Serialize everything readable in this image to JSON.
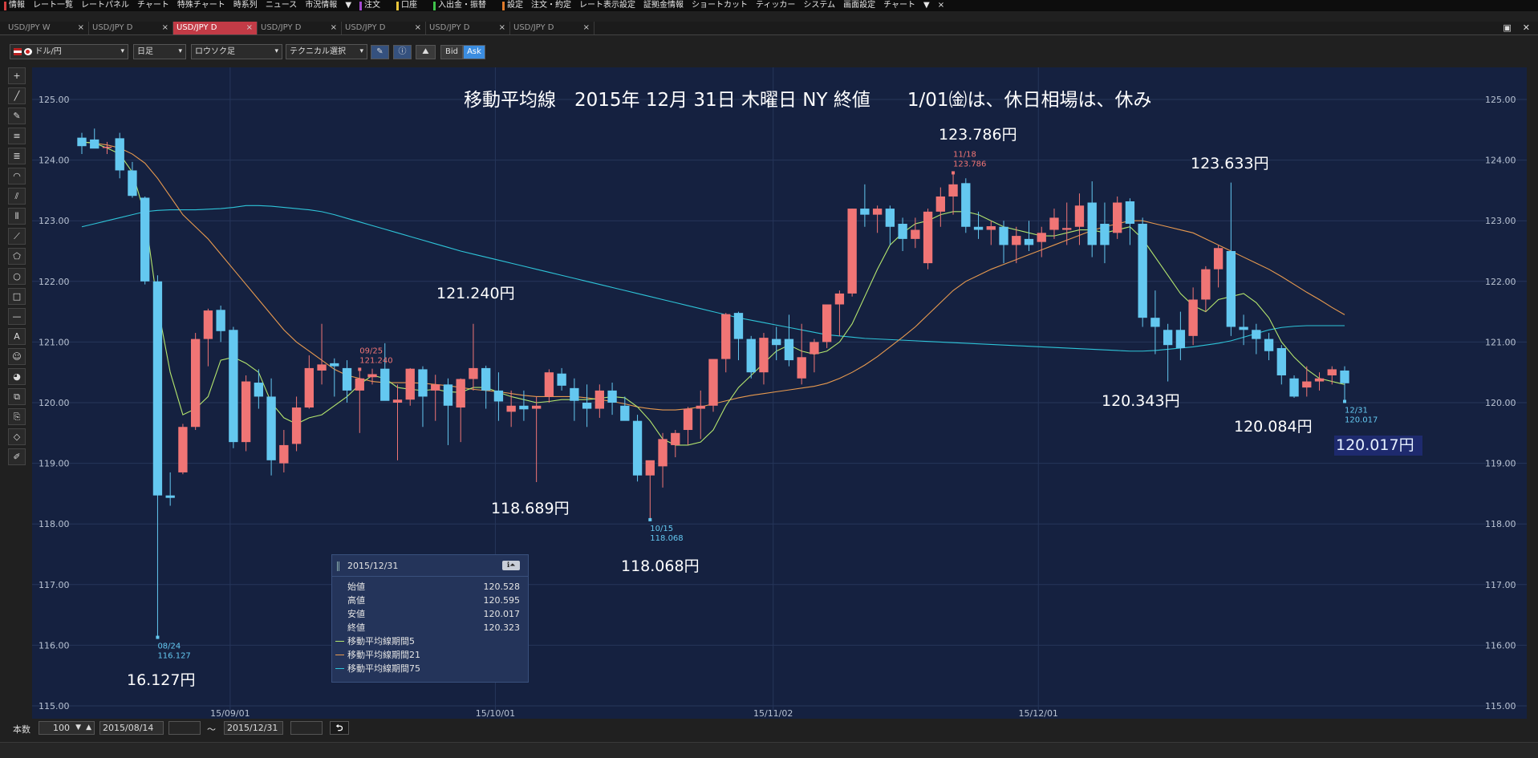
{
  "menu": [
    {
      "label": "情報",
      "marker": "#d34040"
    },
    {
      "label": "レート一覧"
    },
    {
      "label": "レートパネル"
    },
    {
      "label": "チャート"
    },
    {
      "label": "特殊チャート"
    },
    {
      "label": "時系列"
    },
    {
      "label": "ニュース"
    },
    {
      "label": "市況情報"
    },
    {
      "label": "▼"
    },
    {
      "label": "注文",
      "marker": "#a44ad2"
    },
    {
      "label": ""
    },
    {
      "label": "口座",
      "marker": "#e8c43a"
    },
    {
      "label": ""
    },
    {
      "label": "入出金・振替",
      "marker": "#3fc24a"
    },
    {
      "label": ""
    },
    {
      "label": "設定",
      "marker": "#e07a2a"
    },
    {
      "label": "注文・約定"
    },
    {
      "label": "レート表示設定"
    },
    {
      "label": "証拠金情報"
    },
    {
      "label": "ショートカット"
    },
    {
      "label": "ティッカー"
    },
    {
      "label": "システム"
    },
    {
      "label": "画面設定"
    },
    {
      "label": "チャート"
    },
    {
      "label": "▼"
    },
    {
      "label": "×"
    }
  ],
  "tabs": [
    {
      "label": "USD/JPY W",
      "active": false
    },
    {
      "label": "USD/JPY D",
      "active": false
    },
    {
      "label": "USD/JPY D",
      "active": true
    },
    {
      "label": "USD/JPY D",
      "active": false
    },
    {
      "label": "USD/JPY D",
      "active": false
    },
    {
      "label": "USD/JPY D",
      "active": false
    },
    {
      "label": "USD/JPY D",
      "active": false
    }
  ],
  "tab_close": "×",
  "window_buttons": [
    "▣",
    "✕"
  ],
  "toolbar": {
    "currency": "ドル/円",
    "timeframe": "日足",
    "chart_type": "ロウソク足",
    "technical": "テクニカル選択",
    "bid": "Bid",
    "ask": "Ask",
    "dropdown_arrow": "▾"
  },
  "left_tools": [
    "+",
    "╱",
    "✎",
    "≡",
    "≣",
    "◠",
    "⫽",
    "⦀",
    "⟋",
    "⬠",
    "○",
    "□",
    "—",
    "A",
    "☺",
    "◕",
    "⧉",
    "⎘",
    "◇",
    "✐"
  ],
  "chart_data": {
    "type": "candlestick",
    "title": "移動平均線　2015年 12月 31日 木曜日 NY 終値　　1/01㈮は、休日相場は、休み",
    "y_ticks": [
      "125.00",
      "124.00",
      "123.00",
      "122.00",
      "121.00",
      "120.00",
      "119.00",
      "118.00",
      "117.00",
      "116.00",
      "115.00"
    ],
    "ylim": [
      115.0,
      125.0
    ],
    "x_ticks": [
      "15/09/01",
      "15/10/01",
      "15/11/02",
      "15/12/01"
    ],
    "up_color": "#f07575",
    "down_color": "#64c8f0",
    "candles": [
      {
        "o": 124.37,
        "h": 124.45,
        "l": 124.1,
        "c": 124.23
      },
      {
        "o": 124.34,
        "h": 124.52,
        "l": 124.2,
        "c": 124.19
      },
      {
        "o": 124.2,
        "h": 124.3,
        "l": 124.1,
        "c": 124.22
      },
      {
        "o": 124.36,
        "h": 124.45,
        "l": 123.7,
        "c": 123.83
      },
      {
        "o": 123.83,
        "h": 123.97,
        "l": 123.38,
        "c": 123.41
      },
      {
        "o": 123.38,
        "h": 123.4,
        "l": 121.95,
        "c": 122.0
      },
      {
        "o": 122.0,
        "h": 122.1,
        "l": 116.13,
        "c": 118.47
      },
      {
        "o": 118.47,
        "h": 118.85,
        "l": 118.3,
        "c": 118.43
      },
      {
        "o": 118.85,
        "h": 119.65,
        "l": 118.82,
        "c": 119.6
      },
      {
        "o": 119.6,
        "h": 121.15,
        "l": 119.55,
        "c": 121.05
      },
      {
        "o": 121.05,
        "h": 121.55,
        "l": 120.6,
        "c": 121.52
      },
      {
        "o": 121.53,
        "h": 121.6,
        "l": 121.0,
        "c": 121.18
      },
      {
        "o": 121.2,
        "h": 121.25,
        "l": 119.25,
        "c": 119.35
      },
      {
        "o": 119.35,
        "h": 120.45,
        "l": 119.2,
        "c": 120.35
      },
      {
        "o": 120.33,
        "h": 120.55,
        "l": 119.9,
        "c": 120.1
      },
      {
        "o": 120.1,
        "h": 120.4,
        "l": 118.8,
        "c": 119.05
      },
      {
        "o": 119.0,
        "h": 119.55,
        "l": 118.85,
        "c": 119.3
      },
      {
        "o": 119.32,
        "h": 120.1,
        "l": 119.2,
        "c": 119.92
      },
      {
        "o": 119.92,
        "h": 120.78,
        "l": 119.9,
        "c": 120.57
      },
      {
        "o": 120.53,
        "h": 121.3,
        "l": 120.3,
        "c": 120.63
      },
      {
        "o": 120.65,
        "h": 120.73,
        "l": 120.1,
        "c": 120.6
      },
      {
        "o": 120.57,
        "h": 120.7,
        "l": 120.0,
        "c": 120.2
      },
      {
        "o": 120.2,
        "h": 120.55,
        "l": 119.5,
        "c": 120.4
      },
      {
        "o": 120.42,
        "h": 120.56,
        "l": 120.3,
        "c": 120.47
      },
      {
        "o": 120.56,
        "h": 120.98,
        "l": 120.1,
        "c": 120.03
      },
      {
        "o": 120.0,
        "h": 120.3,
        "l": 119.05,
        "c": 120.05
      },
      {
        "o": 120.05,
        "h": 120.57,
        "l": 119.95,
        "c": 120.56
      },
      {
        "o": 120.55,
        "h": 120.6,
        "l": 119.6,
        "c": 120.1
      },
      {
        "o": 120.2,
        "h": 120.46,
        "l": 119.7,
        "c": 120.3
      },
      {
        "o": 120.3,
        "h": 120.4,
        "l": 119.3,
        "c": 119.95
      },
      {
        "o": 119.92,
        "h": 120.4,
        "l": 119.35,
        "c": 120.39
      },
      {
        "o": 120.39,
        "h": 121.3,
        "l": 120.2,
        "c": 120.57
      },
      {
        "o": 120.57,
        "h": 120.61,
        "l": 119.9,
        "c": 120.2
      },
      {
        "o": 120.2,
        "h": 120.5,
        "l": 119.7,
        "c": 120.02
      },
      {
        "o": 119.85,
        "h": 120.2,
        "l": 119.6,
        "c": 119.95
      },
      {
        "o": 119.95,
        "h": 120.2,
        "l": 119.7,
        "c": 119.89
      },
      {
        "o": 119.9,
        "h": 120.1,
        "l": 118.69,
        "c": 119.95
      },
      {
        "o": 120.1,
        "h": 120.55,
        "l": 120.0,
        "c": 120.5
      },
      {
        "o": 120.48,
        "h": 120.57,
        "l": 120.2,
        "c": 120.28
      },
      {
        "o": 120.24,
        "h": 120.4,
        "l": 119.7,
        "c": 120.03
      },
      {
        "o": 120.0,
        "h": 120.3,
        "l": 119.6,
        "c": 119.9
      },
      {
        "o": 119.9,
        "h": 120.3,
        "l": 119.75,
        "c": 120.2
      },
      {
        "o": 120.2,
        "h": 120.33,
        "l": 119.8,
        "c": 120.0
      },
      {
        "o": 119.95,
        "h": 120.1,
        "l": 119.75,
        "c": 119.7
      },
      {
        "o": 119.7,
        "h": 119.8,
        "l": 118.7,
        "c": 118.8
      },
      {
        "o": 118.8,
        "h": 119.0,
        "l": 118.07,
        "c": 119.05
      },
      {
        "o": 118.95,
        "h": 119.5,
        "l": 118.6,
        "c": 119.4
      },
      {
        "o": 119.3,
        "h": 119.55,
        "l": 119.1,
        "c": 119.5
      },
      {
        "o": 119.55,
        "h": 119.93,
        "l": 119.3,
        "c": 119.9
      },
      {
        "o": 119.9,
        "h": 120.2,
        "l": 119.4,
        "c": 119.95
      },
      {
        "o": 119.95,
        "h": 120.7,
        "l": 119.85,
        "c": 120.72
      },
      {
        "o": 120.72,
        "h": 121.48,
        "l": 120.5,
        "c": 121.46
      },
      {
        "o": 121.48,
        "h": 121.5,
        "l": 120.7,
        "c": 121.05
      },
      {
        "o": 121.05,
        "h": 121.1,
        "l": 120.4,
        "c": 120.5
      },
      {
        "o": 120.5,
        "h": 121.15,
        "l": 120.3,
        "c": 121.07
      },
      {
        "o": 121.05,
        "h": 121.25,
        "l": 120.7,
        "c": 120.95
      },
      {
        "o": 121.05,
        "h": 121.45,
        "l": 120.6,
        "c": 120.7
      },
      {
        "o": 120.4,
        "h": 121.3,
        "l": 120.3,
        "c": 120.75
      },
      {
        "o": 120.8,
        "h": 121.05,
        "l": 120.5,
        "c": 121.0
      },
      {
        "o": 121.0,
        "h": 121.55,
        "l": 120.9,
        "c": 121.62
      },
      {
        "o": 121.62,
        "h": 121.85,
        "l": 121.1,
        "c": 121.8
      },
      {
        "o": 121.8,
        "h": 123.2,
        "l": 121.75,
        "c": 123.2
      },
      {
        "o": 123.2,
        "h": 123.6,
        "l": 122.9,
        "c": 123.1
      },
      {
        "o": 123.1,
        "h": 123.25,
        "l": 122.8,
        "c": 123.2
      },
      {
        "o": 123.2,
        "h": 123.25,
        "l": 122.6,
        "c": 122.9
      },
      {
        "o": 122.95,
        "h": 123.05,
        "l": 122.5,
        "c": 122.7
      },
      {
        "o": 122.7,
        "h": 123.05,
        "l": 122.55,
        "c": 122.85
      },
      {
        "o": 122.3,
        "h": 123.2,
        "l": 122.2,
        "c": 123.15
      },
      {
        "o": 123.15,
        "h": 123.55,
        "l": 122.9,
        "c": 123.4
      },
      {
        "o": 123.4,
        "h": 123.79,
        "l": 123.1,
        "c": 123.6
      },
      {
        "o": 123.62,
        "h": 123.7,
        "l": 122.8,
        "c": 122.9
      },
      {
        "o": 122.9,
        "h": 123.15,
        "l": 122.7,
        "c": 122.85
      },
      {
        "o": 122.85,
        "h": 123.0,
        "l": 122.6,
        "c": 122.91
      },
      {
        "o": 122.9,
        "h": 123.0,
        "l": 122.3,
        "c": 122.6
      },
      {
        "o": 122.6,
        "h": 122.9,
        "l": 122.3,
        "c": 122.75
      },
      {
        "o": 122.7,
        "h": 123.0,
        "l": 122.5,
        "c": 122.6
      },
      {
        "o": 122.65,
        "h": 122.9,
        "l": 122.4,
        "c": 122.8
      },
      {
        "o": 122.85,
        "h": 123.2,
        "l": 122.7,
        "c": 123.05
      },
      {
        "o": 122.85,
        "h": 123.3,
        "l": 122.6,
        "c": 122.88
      },
      {
        "o": 122.9,
        "h": 123.45,
        "l": 122.6,
        "c": 123.25
      },
      {
        "o": 123.3,
        "h": 123.65,
        "l": 122.4,
        "c": 122.6
      },
      {
        "o": 122.95,
        "h": 123.3,
        "l": 122.3,
        "c": 122.6
      },
      {
        "o": 122.8,
        "h": 123.4,
        "l": 122.7,
        "c": 123.3
      },
      {
        "o": 123.32,
        "h": 123.37,
        "l": 122.6,
        "c": 122.95
      },
      {
        "o": 122.95,
        "h": 123.05,
        "l": 121.25,
        "c": 121.4
      },
      {
        "o": 121.4,
        "h": 121.85,
        "l": 120.8,
        "c": 121.25
      },
      {
        "o": 121.2,
        "h": 121.3,
        "l": 120.35,
        "c": 120.95
      },
      {
        "o": 121.2,
        "h": 121.5,
        "l": 120.7,
        "c": 120.9
      },
      {
        "o": 121.1,
        "h": 121.9,
        "l": 120.95,
        "c": 121.7
      },
      {
        "o": 121.7,
        "h": 122.25,
        "l": 121.5,
        "c": 122.2
      },
      {
        "o": 122.2,
        "h": 122.6,
        "l": 121.9,
        "c": 122.55
      },
      {
        "o": 122.5,
        "h": 123.63,
        "l": 121.1,
        "c": 121.25
      },
      {
        "o": 121.25,
        "h": 121.45,
        "l": 120.95,
        "c": 121.2
      },
      {
        "o": 121.2,
        "h": 121.3,
        "l": 120.8,
        "c": 121.05
      },
      {
        "o": 121.05,
        "h": 121.15,
        "l": 120.7,
        "c": 120.85
      },
      {
        "o": 120.9,
        "h": 120.95,
        "l": 120.3,
        "c": 120.45
      },
      {
        "o": 120.4,
        "h": 120.45,
        "l": 120.08,
        "c": 120.1
      },
      {
        "o": 120.25,
        "h": 120.6,
        "l": 120.1,
        "c": 120.35
      },
      {
        "o": 120.35,
        "h": 120.5,
        "l": 120.2,
        "c": 120.4
      },
      {
        "o": 120.45,
        "h": 120.6,
        "l": 120.3,
        "c": 120.55
      },
      {
        "o": 120.53,
        "h": 120.6,
        "l": 120.02,
        "c": 120.32
      }
    ],
    "ma5": [
      124.3,
      124.28,
      124.2,
      124.1,
      123.8,
      123.1,
      121.6,
      120.5,
      119.8,
      119.9,
      120.1,
      120.7,
      120.75,
      120.65,
      120.5,
      120.0,
      119.75,
      119.65,
      119.75,
      119.8,
      119.95,
      120.1,
      120.3,
      120.45,
      120.4,
      120.25,
      120.22,
      120.2,
      120.22,
      120.18,
      120.17,
      120.25,
      120.25,
      120.17,
      120.1,
      120.05,
      120.0,
      120.02,
      120.05,
      120.05,
      120.05,
      120.07,
      120.1,
      120.08,
      119.93,
      119.7,
      119.4,
      119.3,
      119.3,
      119.35,
      119.55,
      119.95,
      120.25,
      120.45,
      120.65,
      120.85,
      120.95,
      120.85,
      120.8,
      120.85,
      121.0,
      121.3,
      121.75,
      122.2,
      122.6,
      122.8,
      122.95,
      123.0,
      123.1,
      123.15,
      123.15,
      123.1,
      123.0,
      122.9,
      122.85,
      122.8,
      122.75,
      122.75,
      122.8,
      122.85,
      122.85,
      122.8,
      122.85,
      122.9,
      122.7,
      122.4,
      122.1,
      121.8,
      121.6,
      121.5,
      121.7,
      121.75,
      121.8,
      121.65,
      121.4,
      121.0,
      120.75,
      120.55,
      120.4,
      120.35,
      120.3
    ],
    "ma21": [
      124.3,
      124.28,
      124.25,
      124.2,
      124.1,
      123.95,
      123.7,
      123.4,
      123.1,
      122.9,
      122.7,
      122.45,
      122.2,
      121.95,
      121.7,
      121.45,
      121.2,
      121.0,
      120.85,
      120.7,
      120.55,
      120.45,
      120.4,
      120.35,
      120.33,
      120.33,
      120.33,
      120.32,
      120.3,
      120.28,
      120.25,
      120.22,
      120.2,
      120.18,
      120.15,
      120.12,
      120.1,
      120.1,
      120.1,
      120.1,
      120.08,
      120.05,
      120.02,
      119.98,
      119.93,
      119.9,
      119.88,
      119.88,
      119.9,
      119.93,
      119.98,
      120.03,
      120.08,
      120.12,
      120.15,
      120.18,
      120.21,
      120.24,
      120.27,
      120.32,
      120.4,
      120.5,
      120.62,
      120.76,
      120.92,
      121.08,
      121.25,
      121.45,
      121.65,
      121.85,
      122.0,
      122.1,
      122.2,
      122.28,
      122.36,
      122.44,
      122.52,
      122.6,
      122.68,
      122.76,
      122.84,
      122.9,
      122.95,
      123.0,
      123.0,
      122.95,
      122.9,
      122.85,
      122.8,
      122.7,
      122.6,
      122.5,
      122.4,
      122.3,
      122.2,
      122.08,
      121.95,
      121.82,
      121.7,
      121.57,
      121.45
    ],
    "ma75": [
      122.9,
      122.95,
      123.0,
      123.05,
      123.1,
      123.15,
      123.17,
      123.18,
      123.18,
      123.18,
      123.19,
      123.2,
      123.22,
      123.25,
      123.25,
      123.24,
      123.22,
      123.2,
      123.18,
      123.15,
      123.1,
      123.04,
      122.98,
      122.92,
      122.86,
      122.8,
      122.74,
      122.68,
      122.62,
      122.56,
      122.5,
      122.45,
      122.4,
      122.35,
      122.3,
      122.25,
      122.2,
      122.15,
      122.1,
      122.05,
      122.0,
      121.95,
      121.9,
      121.85,
      121.8,
      121.75,
      121.7,
      121.65,
      121.6,
      121.55,
      121.5,
      121.45,
      121.4,
      121.36,
      121.32,
      121.28,
      121.24,
      121.2,
      121.16,
      121.12,
      121.1,
      121.08,
      121.06,
      121.05,
      121.04,
      121.03,
      121.02,
      121.01,
      121.0,
      120.99,
      120.98,
      120.97,
      120.96,
      120.95,
      120.94,
      120.93,
      120.92,
      120.91,
      120.9,
      120.89,
      120.88,
      120.87,
      120.86,
      120.85,
      120.85,
      120.86,
      120.88,
      120.9,
      120.92,
      120.95,
      120.98,
      121.02,
      121.08,
      121.14,
      121.2,
      121.24,
      121.26,
      121.27,
      121.27,
      121.27,
      121.27
    ],
    "ma_colors": {
      "ma5": "#b4e66e",
      "ma21": "#e89a4f",
      "ma75": "#2ec4d8"
    },
    "markers": [
      {
        "idx": 6,
        "side": "low",
        "date": "08/24",
        "value": "116.127"
      },
      {
        "idx": 22,
        "side": "high",
        "date": "09/25",
        "value": "121.240"
      },
      {
        "idx": 45,
        "side": "low",
        "date": "10/15",
        "value": "118.068"
      },
      {
        "idx": 69,
        "side": "high",
        "date": "11/18",
        "value": "123.786"
      },
      {
        "idx": 100,
        "side": "low",
        "date": "12/31",
        "value": "120.017"
      }
    ],
    "annotations": [
      {
        "text": "16.127円",
        "near": "bottom-left"
      },
      {
        "text": "121.240円",
        "near": "09/25 high"
      },
      {
        "text": "118.689円",
        "near": "10/06 low"
      },
      {
        "text": "118.068円",
        "near": "10/15 low"
      },
      {
        "text": "123.786円",
        "near": "11/18 high"
      },
      {
        "text": "123.633円",
        "near": "12/18 high"
      },
      {
        "text": "120.343円",
        "near": "12/09 low"
      },
      {
        "text": "120.084円",
        "near": "12/23 low"
      },
      {
        "text": "120.017円",
        "near": "12/31 low",
        "highlight": true
      }
    ]
  },
  "infobox": {
    "date": "2015/12/31",
    "rows": [
      {
        "label": "始値",
        "value": "120.528"
      },
      {
        "label": "高値",
        "value": "120.595"
      },
      {
        "label": "安値",
        "value": "120.017"
      },
      {
        "label": "終値",
        "value": "120.323"
      }
    ],
    "ma_legend": [
      {
        "label": "移動平均線期間5",
        "color": "#b4e66e"
      },
      {
        "label": "移動平均線期間21",
        "color": "#e89a4f"
      },
      {
        "label": "移動平均線期間75",
        "color": "#2ec4d8"
      }
    ],
    "button": "ℹ⏶"
  },
  "bottom": {
    "count_label": "本数",
    "count_value": "100",
    "from_date": "2015/08/14",
    "tilde": "〜",
    "to_date": "2015/12/31",
    "return_icon": "⮌"
  }
}
